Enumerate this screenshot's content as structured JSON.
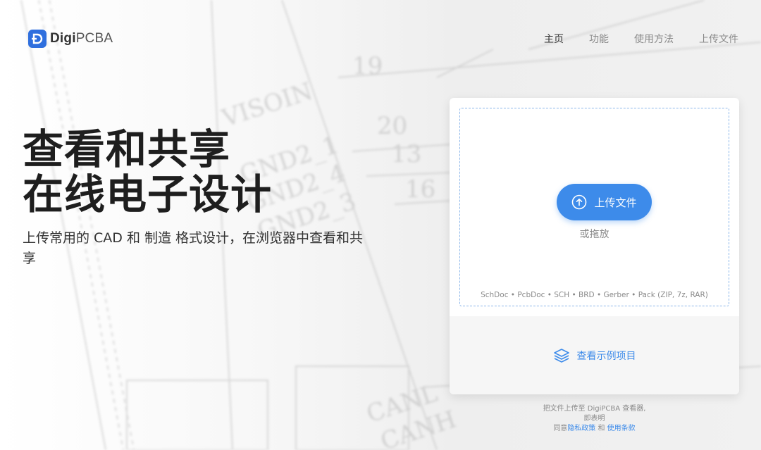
{
  "brand": {
    "name_bold": "Digi",
    "name_light": "PCBA"
  },
  "nav": [
    {
      "label": "主页",
      "active": true
    },
    {
      "label": "功能",
      "active": false
    },
    {
      "label": "使用方法",
      "active": false
    },
    {
      "label": "上传文件",
      "active": false
    }
  ],
  "hero": {
    "title_line1": "查看和共享",
    "title_line2": "在线电子设计",
    "subtitle": "上传常用的 CAD 和 制造 格式设计，在浏览器中查看和共享"
  },
  "upload": {
    "button_label": "上传文件",
    "or_drag": "或拖放",
    "formats": "SchDoc • PcbDoc • SCH • BRD • Gerber • Pack (ZIP, 7z, RAR)",
    "examples_label": "查看示例项目"
  },
  "terms": {
    "line1": "把文件上传至 DigiPCBA 查看器,",
    "line2": "即表明",
    "line3_prefix": "同意",
    "privacy_link": "隐私政策",
    "and": " 和 ",
    "terms_link": "使用条款"
  },
  "colors": {
    "accent": "#3d8bea",
    "brand": "#2f6fde"
  },
  "background_text": [
    "VISOIN",
    "GND2_1",
    "GND2_4",
    "GND2_3",
    "19",
    "20",
    "13",
    "16",
    "CANL",
    "CANH"
  ]
}
